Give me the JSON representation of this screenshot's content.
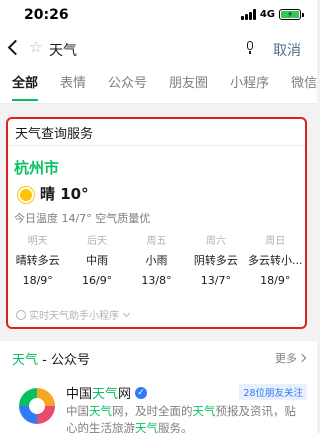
{
  "status": {
    "time": "20:26",
    "network": "4G"
  },
  "search": {
    "query": "天气",
    "cancel_label": "取消"
  },
  "tabs": [
    "全部",
    "表情",
    "公众号",
    "朋友圈",
    "小程序",
    "微信"
  ],
  "weather": {
    "title": "天气查询服务",
    "city": "杭州市",
    "current": "晴 10°",
    "today": "今日温度 14/7° 空气质量优",
    "forecast": [
      {
        "day": "明天",
        "cond": "晴转多云",
        "temp": "18/9°"
      },
      {
        "day": "后天",
        "cond": "中雨",
        "temp": "16/9°"
      },
      {
        "day": "周五",
        "cond": "小雨",
        "temp": "13/8°"
      },
      {
        "day": "周六",
        "cond": "阴转多云",
        "temp": "13/7°"
      },
      {
        "day": "周日",
        "cond": "多云转小...",
        "temp": "18/9°"
      }
    ],
    "mini_program": "实时天气助手小程序"
  },
  "account": {
    "section_hl": "天气",
    "section_rest": " - 公众号",
    "more_label": "更多",
    "name_pre": "中国",
    "name_hl": "天气",
    "name_post": "网",
    "friends": "28位朋友关注",
    "desc_1": "中国",
    "desc_2": "天气",
    "desc_3": "网，及时全面的",
    "desc_4": "天气",
    "desc_5": "预报及资讯，贴心的生活旅游",
    "desc_6": "天气",
    "desc_7": "服务。"
  },
  "colors": {
    "accent": "#07c160",
    "link": "#576b95",
    "highlight_border": "#e02020",
    "verified": "#2e7cf6"
  }
}
